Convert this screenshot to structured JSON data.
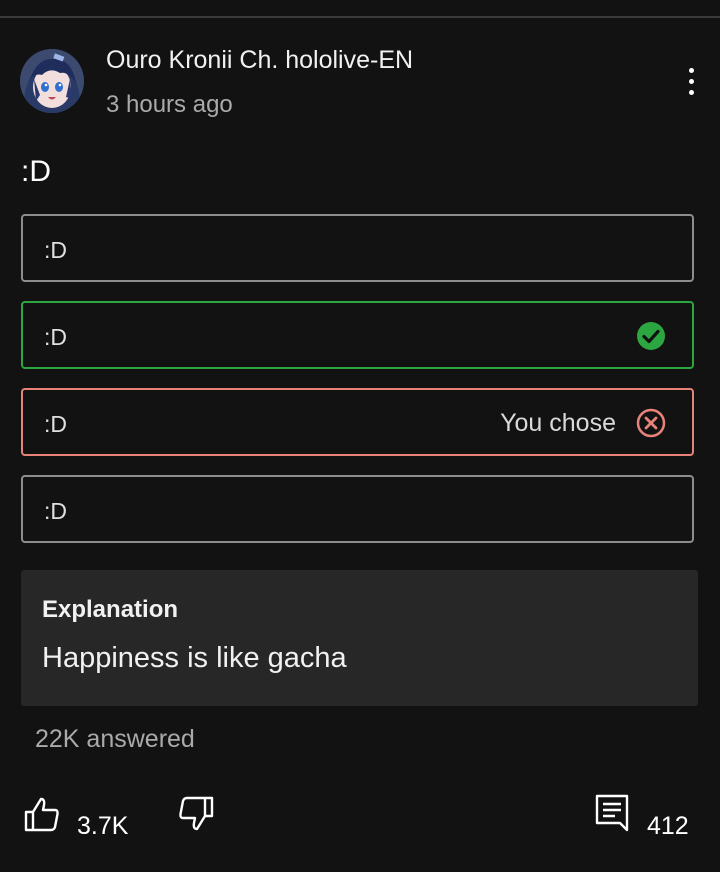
{
  "post": {
    "channel_name": "Ouro Kronii Ch. hololive-EN",
    "time_ago": "3 hours ago",
    "text": ":D",
    "avatar_icon": "channel-avatar",
    "menu_icon": "more-vert-icon"
  },
  "quiz": {
    "options": [
      {
        "label": ":D",
        "state": "default"
      },
      {
        "label": ":D",
        "state": "correct"
      },
      {
        "label": ":D",
        "state": "wrong-chosen",
        "chosen_label": "You chose"
      },
      {
        "label": ":D",
        "state": "default"
      }
    ],
    "explanation": {
      "title": "Explanation",
      "text": "Happiness is like gacha"
    },
    "answered": "22K answered"
  },
  "actions": {
    "likes": "3.7K",
    "comments": "412",
    "like_icon": "thumb-up-icon",
    "dislike_icon": "thumb-down-icon",
    "comment_icon": "comment-icon"
  },
  "colors": {
    "background": "#121212",
    "correct": "#2ba640",
    "wrong": "#e8837a",
    "panel": "#272727"
  }
}
